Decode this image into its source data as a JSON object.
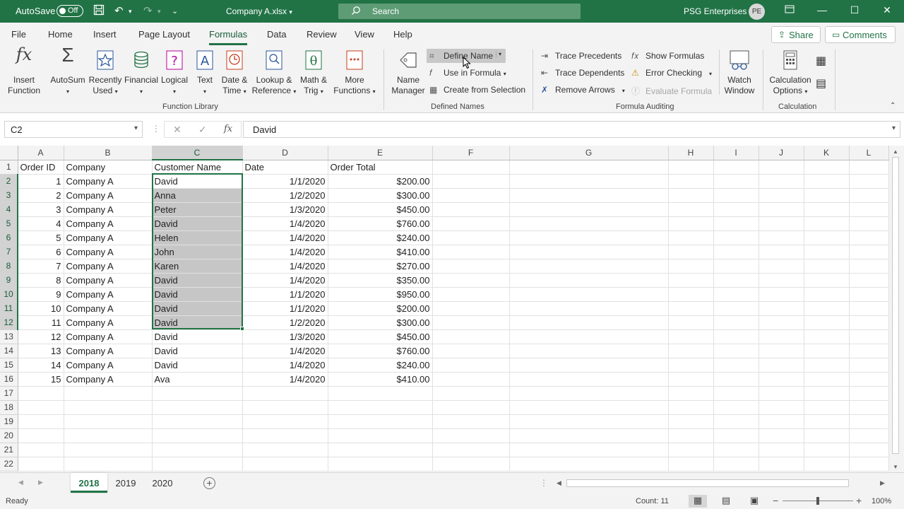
{
  "titlebar": {
    "autosave_label": "AutoSave",
    "autosave_state": "Off",
    "filename": "Company A.xlsx",
    "search_placeholder": "Search",
    "org_name": "PSG Enterprises",
    "avatar_initials": "PE"
  },
  "menu": {
    "tabs": [
      "File",
      "Home",
      "Insert",
      "Page Layout",
      "Formulas",
      "Data",
      "Review",
      "View",
      "Help"
    ],
    "active_tab": "Formulas",
    "share_label": "Share",
    "comments_label": "Comments"
  },
  "ribbon": {
    "function_library": {
      "label": "Function Library",
      "insert_function": [
        "Insert",
        "Function"
      ],
      "autosum": [
        "AutoSum",
        ""
      ],
      "recently_used": [
        "Recently",
        "Used"
      ],
      "financial": [
        "Financial",
        ""
      ],
      "logical": [
        "Logical",
        ""
      ],
      "text": [
        "Text",
        ""
      ],
      "date_time": [
        "Date &",
        "Time"
      ],
      "lookup_reference": [
        "Lookup &",
        "Reference"
      ],
      "math_trig": [
        "Math &",
        "Trig"
      ],
      "more_functions": [
        "More",
        "Functions"
      ]
    },
    "defined_names": {
      "label": "Defined Names",
      "name_manager": [
        "Name",
        "Manager"
      ],
      "define_name": "Define Name",
      "use_in_formula": "Use in Formula",
      "create_from_selection": "Create from Selection"
    },
    "formula_auditing": {
      "label": "Formula Auditing",
      "trace_precedents": "Trace Precedents",
      "trace_dependents": "Trace Dependents",
      "remove_arrows": "Remove Arrows",
      "show_formulas": "Show Formulas",
      "error_checking": "Error Checking",
      "evaluate_formula": "Evaluate Formula",
      "watch_window": [
        "Watch",
        "Window"
      ]
    },
    "calculation": {
      "label": "Calculation",
      "calculation_options": [
        "Calculation",
        "Options"
      ]
    }
  },
  "formula_bar": {
    "name_box": "C2",
    "formula": "David"
  },
  "grid": {
    "columns": [
      "A",
      "B",
      "C",
      "D",
      "E",
      "F",
      "G",
      "H",
      "I",
      "J",
      "K",
      "L"
    ],
    "selected_column": "C",
    "selected_rows": [
      2,
      3,
      4,
      5,
      6,
      7,
      8,
      9,
      10,
      11,
      12
    ],
    "row_numbers": [
      1,
      2,
      3,
      4,
      5,
      6,
      7,
      8,
      9,
      10,
      11,
      12,
      13,
      14,
      15,
      16,
      17,
      18,
      19,
      20,
      21,
      22
    ],
    "headers": [
      "Order ID",
      "Company",
      "Customer Name",
      "Date",
      "Order Total"
    ],
    "rows": [
      [
        "1",
        "Company A",
        "David",
        "1/1/2020",
        "$200.00"
      ],
      [
        "2",
        "Company A",
        "Anna",
        "1/2/2020",
        "$300.00"
      ],
      [
        "3",
        "Company A",
        "Peter",
        "1/3/2020",
        "$450.00"
      ],
      [
        "4",
        "Company A",
        "David",
        "1/4/2020",
        "$760.00"
      ],
      [
        "5",
        "Company A",
        "Helen",
        "1/4/2020",
        "$240.00"
      ],
      [
        "6",
        "Company A",
        "John",
        "1/4/2020",
        "$410.00"
      ],
      [
        "7",
        "Company A",
        "Karen",
        "1/4/2020",
        "$270.00"
      ],
      [
        "8",
        "Company A",
        "David",
        "1/4/2020",
        "$350.00"
      ],
      [
        "9",
        "Company A",
        "David",
        "1/1/2020",
        "$950.00"
      ],
      [
        "10",
        "Company A",
        "David",
        "1/1/2020",
        "$200.00"
      ],
      [
        "11",
        "Company A",
        "David",
        "1/2/2020",
        "$300.00"
      ],
      [
        "12",
        "Company A",
        "David",
        "1/3/2020",
        "$450.00"
      ],
      [
        "13",
        "Company A",
        "David",
        "1/4/2020",
        "$760.00"
      ],
      [
        "14",
        "Company A",
        "David",
        "1/4/2020",
        "$240.00"
      ],
      [
        "15",
        "Company A",
        "Ava",
        "1/4/2020",
        "$410.00"
      ]
    ]
  },
  "sheets": {
    "tabs": [
      "2018",
      "2019",
      "2020"
    ],
    "active": "2018"
  },
  "status": {
    "ready": "Ready",
    "count": "Count: 11",
    "zoom": "100%"
  },
  "colors": {
    "brand": "#217346",
    "selection": "#c6c6c6"
  }
}
